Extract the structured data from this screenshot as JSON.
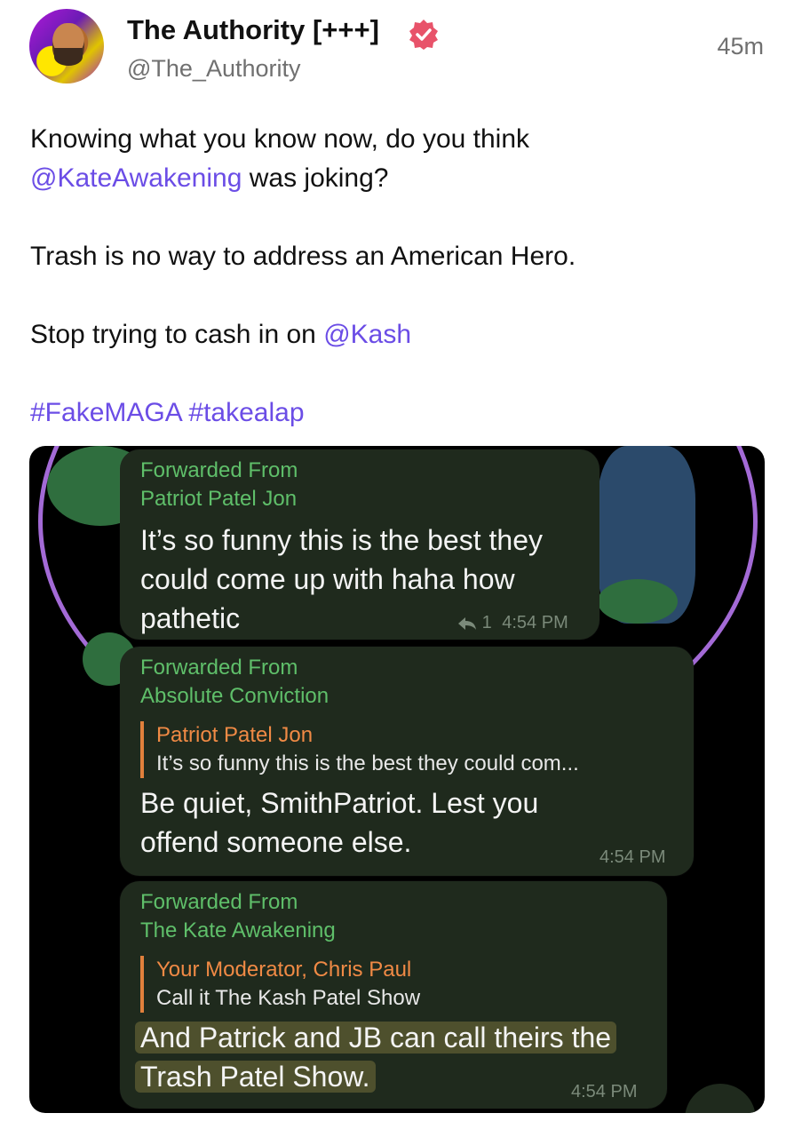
{
  "post": {
    "display_name": "The Authority [+++]",
    "handle": "@The_Authority",
    "timestamp": "45m",
    "verified_icon": "verified-badge-icon",
    "accent_color": "#6b4de6",
    "line1": "Knowing what you know now, do you think",
    "line2_mention": "@KateAwakening",
    "line2_rest": " was joking?",
    "line3": "Trash is no way to address an American Hero.",
    "line4_text": "Stop trying to cash in on ",
    "line4_mention": "@Kash",
    "hashtags": "#FakeMAGA #takealap"
  },
  "media": {
    "messages": [
      {
        "forwarded_label": "Forwarded From",
        "forwarded_source": "Patriot Patel Jon",
        "text_line1": "It’s so funny this is the best they",
        "text_line2": "could come up with haha how",
        "text_line3": "pathetic",
        "reply_count": "1",
        "time": "4:54 PM"
      },
      {
        "forwarded_label": "Forwarded From",
        "forwarded_source": "Absolute Conviction",
        "quote_author": "Patriot Patel Jon",
        "quote_text": "It’s so funny this is the best they could com...",
        "text_line1": "Be quiet, SmithPatriot. Lest you",
        "text_line2": "offend someone else.",
        "time": "4:54 PM"
      },
      {
        "forwarded_label": "Forwarded From",
        "forwarded_source": "The Kate Awakening",
        "quote_author": "Your Moderator, Chris Paul",
        "quote_text": "Call it The Kash Patel Show",
        "text_line1": "And Patrick and JB can call theirs the",
        "text_line2": "Trash Patel Show.",
        "time": "4:54 PM"
      }
    ]
  }
}
